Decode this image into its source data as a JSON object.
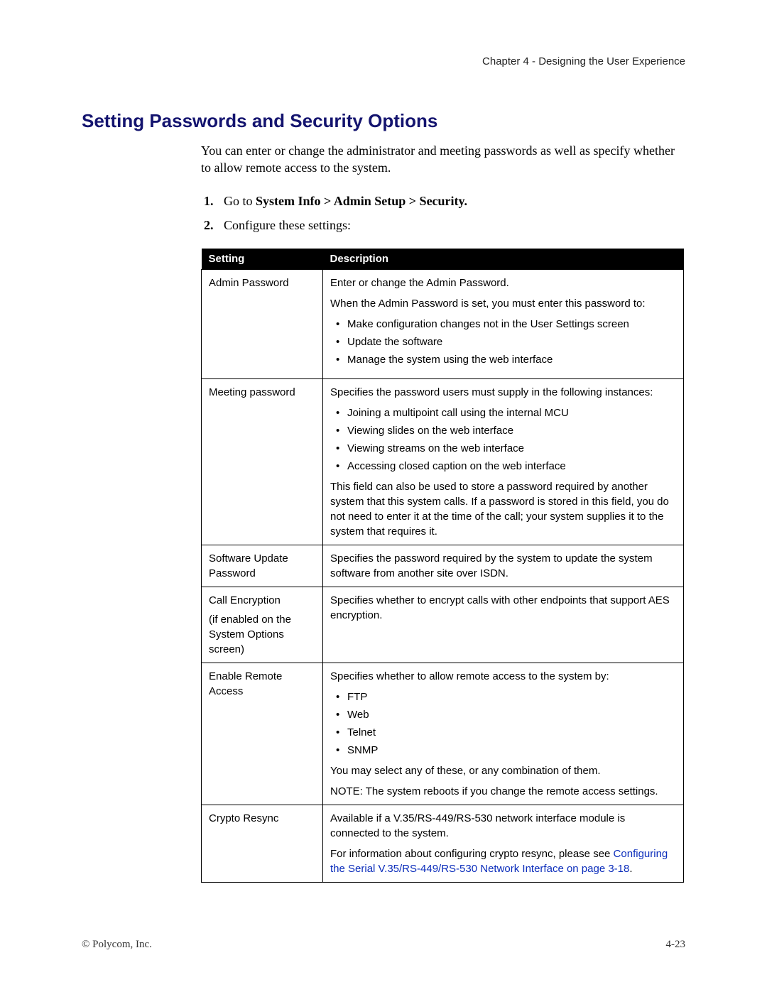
{
  "chapter_header": "Chapter 4 - Designing the User Experience",
  "section_title": "Setting Passwords and Security Options",
  "intro": "You can enter or change the administrator and meeting passwords as well as specify whether to allow remote access to the system.",
  "steps": {
    "s1_prefix": "Go to ",
    "s1_bold": "System Info > Admin Setup > Security.",
    "s2": "Configure these settings:"
  },
  "table": {
    "head_setting": "Setting",
    "head_desc": "Description",
    "rows": [
      {
        "setting": "Admin Password",
        "p1": "Enter or change the Admin Password.",
        "p2": "When the Admin Password is set, you must enter this password to:",
        "bullets": [
          "Make configuration changes not in the User Settings screen",
          "Update the software",
          "Manage the system using the web interface"
        ]
      },
      {
        "setting": "Meeting password",
        "p1": "Specifies the password users must supply in the following instances:",
        "bullets": [
          "Joining a multipoint call using the internal MCU",
          "Viewing slides on the web interface",
          "Viewing streams on the web interface",
          "Accessing closed caption on the web interface"
        ],
        "p2": "This field can also be used to store a password required by another system that this system calls. If a password is stored in this field, you do not need to enter it at the time of the call; your system supplies it to the system that requires it."
      },
      {
        "setting": "Software Update Password",
        "p1": "Specifies the password required by the system to update the system software from another site over ISDN."
      },
      {
        "setting_l1": "Call Encryption",
        "setting_l2": "(if enabled on the System Options screen)",
        "p1": "Specifies whether to encrypt calls with other endpoints that support AES encryption."
      },
      {
        "setting": "Enable Remote Access",
        "p1": "Specifies whether to allow remote access to the system by:",
        "bullets": [
          "FTP",
          "Web",
          "Telnet",
          "SNMP"
        ],
        "p2": "You may select any of these, or any combination of them.",
        "p3": "NOTE: The system reboots if you change the remote access settings."
      },
      {
        "setting": "Crypto Resync",
        "p1": "Available if a V.35/RS-449/RS-530 network interface module is connected to the system.",
        "p2": "For information about configuring crypto resync, please see ",
        "link": "Configuring the Serial V.35/RS-449/RS-530 Network Interface on page 3-18",
        "p2_suffix": "."
      }
    ]
  },
  "footer_left": "© Polycom, Inc.",
  "footer_right": "4-23"
}
